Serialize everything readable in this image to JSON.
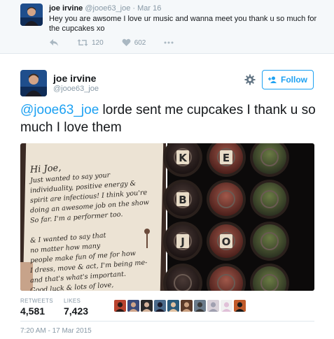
{
  "reply": {
    "name": "joe irvine",
    "meta": "@jooe63_joe · Mar 16",
    "text": "Hey you are awsome I love ur music and wanna meet you thank u so much for the cupcakes xo",
    "retweets": "120",
    "likes": "602"
  },
  "main": {
    "name": "joe irvine",
    "handle": "@jooe63_joe",
    "follow_label": "Follow",
    "mention": "@jooe63_joe",
    "text": " lorde sent me cupcakes I thank u so much I love them"
  },
  "note": {
    "lines": [
      "Hi Joe,",
      "Just wanted to say your",
      "individuality, positive energy &",
      "spirit are infectious! I think you're",
      "doing an awesome job on the show",
      "So far. I'm a performer too.",
      "",
      "& I wanted to say that",
      "no matter how many",
      "people make fun of me for how",
      "I dress, move & act, I'm being me-",
      "and that's what's important.",
      "Good luck & lots of love,"
    ]
  },
  "cupcakes": {
    "letters": [
      "K",
      "E",
      "B",
      "O",
      "J",
      "O"
    ]
  },
  "stats": {
    "retweets_label": "RETWEETS",
    "retweets_value": "4,581",
    "likes_label": "LIKES",
    "likes_value": "7,423"
  },
  "timestamp": "7:20 AM - 17 Mar 2015",
  "colors": {
    "link": "#1da1f2",
    "muted": "#8899a6",
    "reply_bg": "#f5f8fa"
  }
}
